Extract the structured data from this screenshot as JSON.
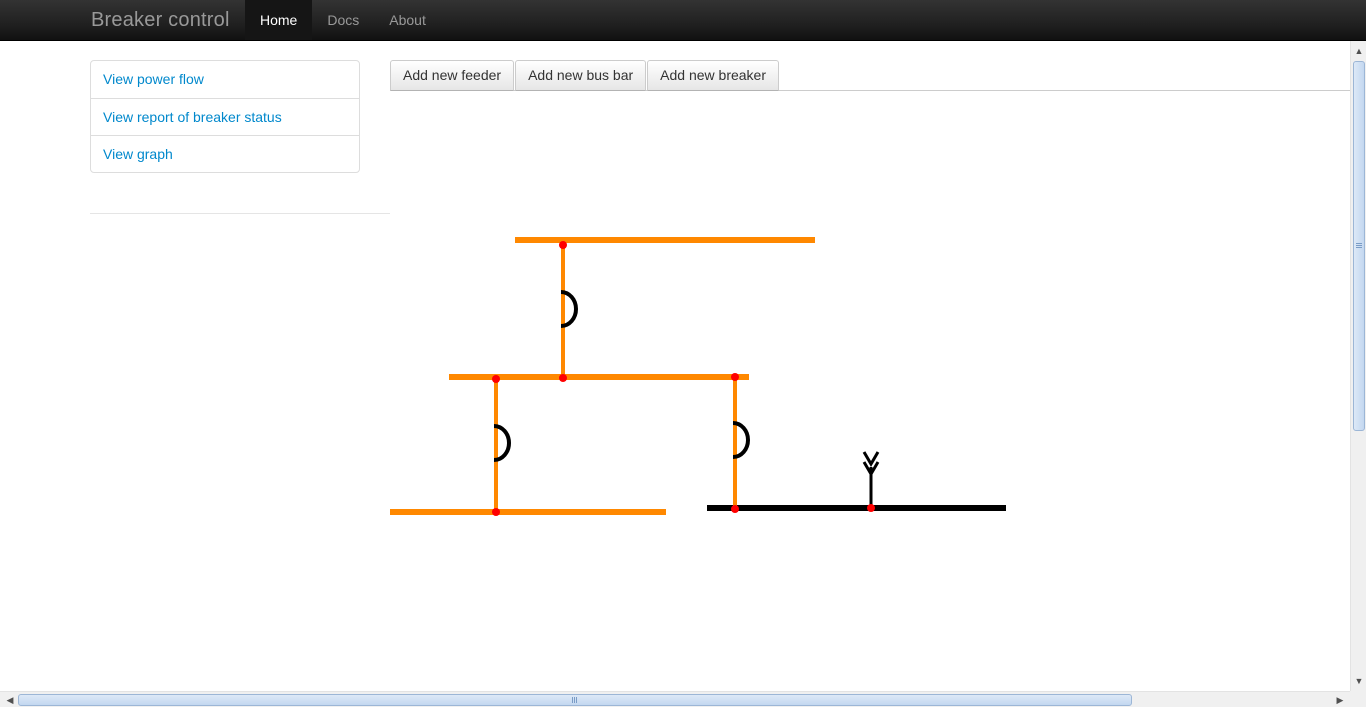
{
  "app": {
    "brand": "Breaker control",
    "nav": [
      {
        "label": "Home",
        "active": true
      },
      {
        "label": "Docs",
        "active": false
      },
      {
        "label": "About",
        "active": false
      }
    ]
  },
  "sidebar": {
    "items": [
      {
        "label": "View power flow"
      },
      {
        "label": "View report of breaker status"
      },
      {
        "label": "View graph"
      }
    ]
  },
  "toolbar": {
    "buttons": [
      {
        "label": "Add new feeder"
      },
      {
        "label": "Add new bus bar"
      },
      {
        "label": "Add new breaker"
      }
    ]
  },
  "diagram": {
    "colors": {
      "energized": "#ff8800",
      "deenergized": "#000000",
      "node": "#ff0000"
    },
    "bus_bars": [
      {
        "id": "bus-top",
        "state": "energized"
      },
      {
        "id": "bus-middle",
        "state": "energized"
      },
      {
        "id": "bus-bottom-left",
        "state": "energized"
      },
      {
        "id": "bus-bottom-right",
        "state": "deenergized"
      }
    ],
    "breakers": [
      {
        "id": "breaker-1",
        "state": "energized"
      },
      {
        "id": "breaker-2",
        "state": "energized"
      },
      {
        "id": "breaker-3",
        "state": "energized"
      }
    ],
    "feeders": [
      {
        "id": "feeder-1",
        "state": "deenergized"
      }
    ]
  }
}
